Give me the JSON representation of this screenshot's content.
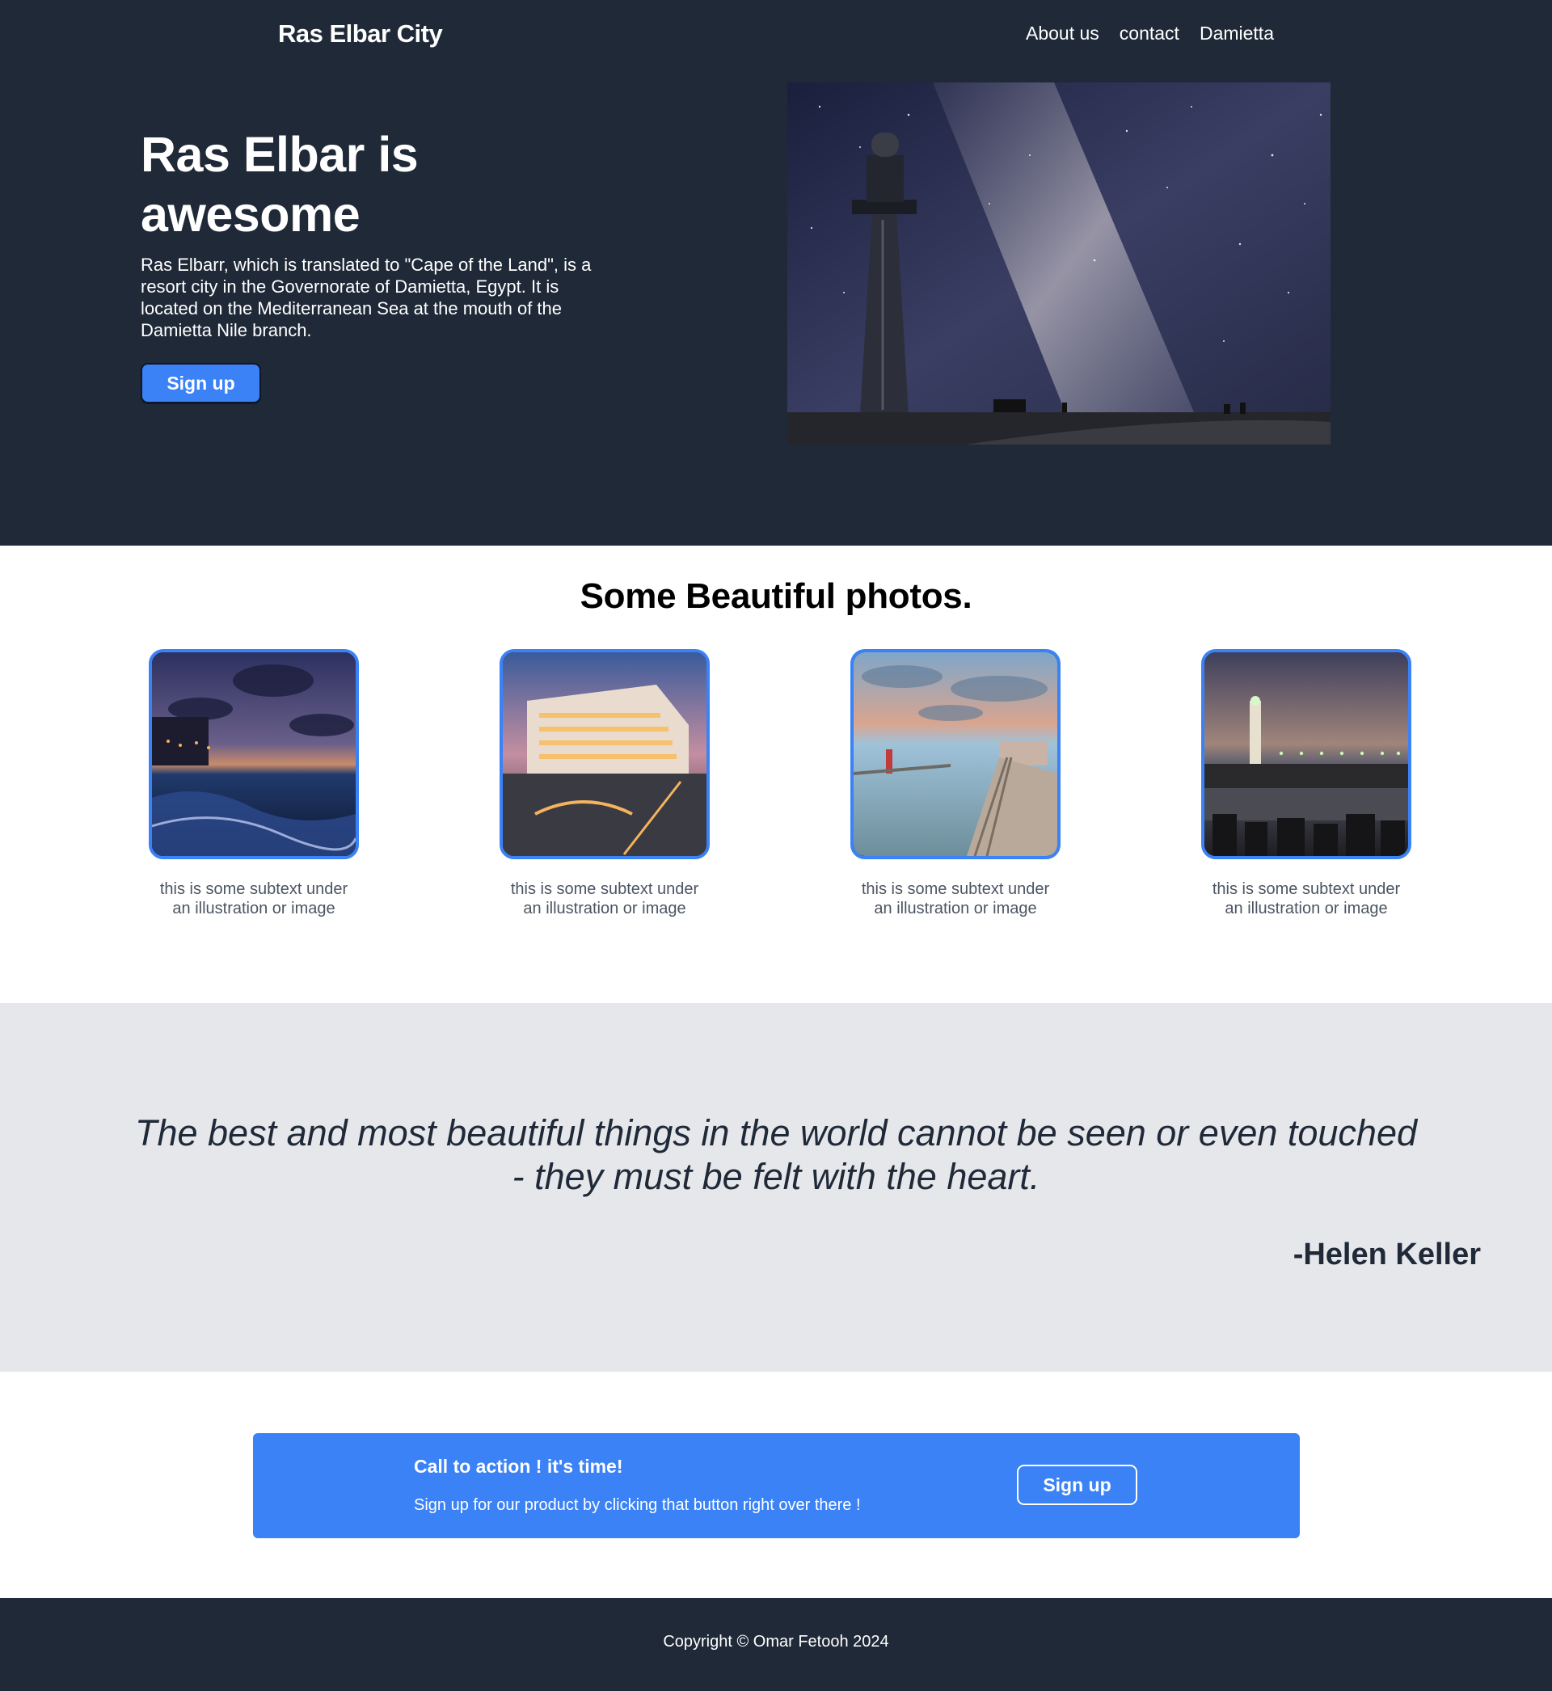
{
  "header": {
    "brand": "Ras Elbar City",
    "nav": [
      "About us",
      "contact",
      "Damietta"
    ]
  },
  "hero": {
    "title_line1": "Ras Elbar is",
    "title_line2": "awesome",
    "description": "Ras Elbarr, which is translated to \"Cape of the Land\", is a resort city in the Governorate of Damietta, Egypt. It is located on the Mediterranean Sea at the mouth of the Damietta Nile branch.",
    "button": "Sign up"
  },
  "gallery": {
    "title": "Some Beautiful photos.",
    "cards": [
      {
        "caption_line1": "this is some subtext under",
        "caption_line2": "an illustration or image"
      },
      {
        "caption_line1": "this is some subtext under",
        "caption_line2": "an illustration or image"
      },
      {
        "caption_line1": "this is some subtext under",
        "caption_line2": "an illustration or image"
      },
      {
        "caption_line1": "this is some subtext under",
        "caption_line2": "an illustration or image"
      }
    ]
  },
  "quote": {
    "text": "The best and most beautiful things in the world cannot be seen or even touched - they must be felt with the heart.",
    "author": "-Helen Keller"
  },
  "cta": {
    "title": "Call to action ! it's time!",
    "subtitle": "Sign up for our product by clicking that button right over there !",
    "button": "Sign up"
  },
  "footer": {
    "text": "Copyright © Omar Fetooh 2024"
  },
  "colors": {
    "dark": "#1f2937",
    "accent": "#3b82f6",
    "quote_bg": "#e5e7eb"
  }
}
